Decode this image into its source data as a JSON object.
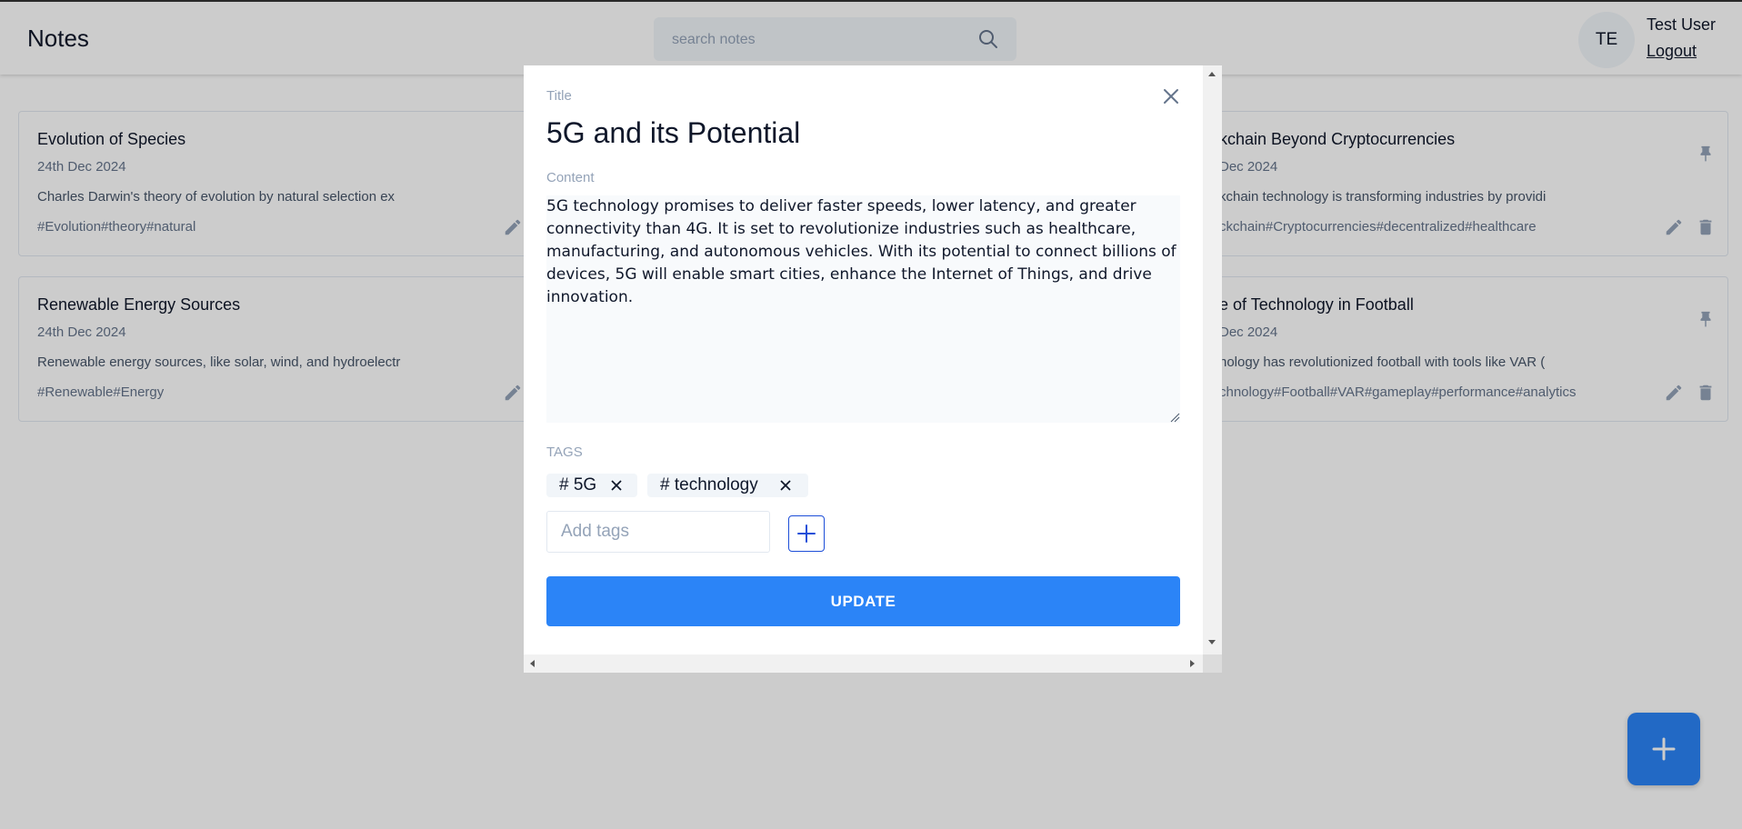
{
  "header": {
    "app_title": "Notes",
    "search_placeholder": "search notes",
    "avatar_initials": "TE",
    "user_name": "Test User",
    "logout_label": "Logout"
  },
  "notes": [
    {
      "title": "Evolution of Species",
      "date": "24th Dec 2024",
      "excerpt": "Charles Darwin's theory of evolution by natural selection ex",
      "tags": "#Evolution#theory#natural"
    },
    {
      "title": "kchain Beyond Cryptocurrencies",
      "date": "Dec 2024",
      "excerpt": "kchain technology is transforming industries by providi",
      "tags": "ckchain#Cryptocurrencies#decentralized#healthcare"
    },
    {
      "title": "Renewable Energy Sources",
      "date": "24th Dec 2024",
      "excerpt": "Renewable energy sources, like solar, wind, and hydroelectr",
      "tags": "#Renewable#Energy"
    },
    {
      "title": "e of Technology in Football",
      "date": "Dec 2024",
      "excerpt": "nology has revolutionized football with tools like VAR (",
      "tags": "chnology#Football#VAR#gameplay#performance#analytics"
    }
  ],
  "modal": {
    "title_label": "Title",
    "title_value": "5G and its Potential",
    "content_label": "Content",
    "content_value": "5G technology promises to deliver faster speeds, lower latency, and greater connectivity than 4G. It is set to revolutionize industries such as healthcare, manufacturing, and autonomous vehicles. With its potential to connect billions of devices, 5G will enable smart cities, enhance the Internet of Things, and drive innovation.",
    "tags_label": "TAGS",
    "tags": [
      "# 5G",
      "# technology"
    ],
    "add_tags_placeholder": "Add tags",
    "update_label": "UPDATE"
  },
  "icons": {
    "search": "search-icon",
    "close": "close-icon",
    "pin": "pin-icon",
    "edit": "pencil-icon",
    "delete": "trash-icon",
    "add": "plus-icon"
  },
  "colors": {
    "accent": "#2b84f7",
    "add_tag_border": "#1d4ed8",
    "muted_text": "#94a3b8"
  }
}
